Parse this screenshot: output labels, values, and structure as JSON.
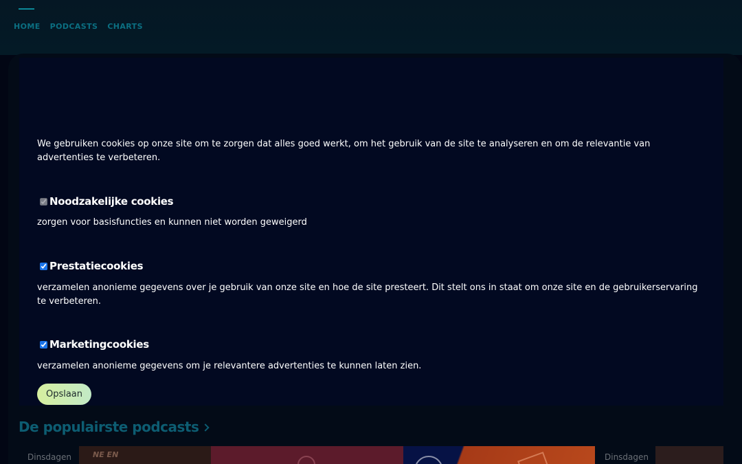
{
  "nav": {
    "items": [
      {
        "label": "HOME"
      },
      {
        "label": "PODCASTS"
      },
      {
        "label": "CHARTS"
      }
    ]
  },
  "cookie_modal": {
    "intro": "We gebruiken cookies op onze site om te zorgen dat alles goed werkt, om het gebruik van de site te analyseren en om de relevantie van advertenties te verbeteren.",
    "categories": [
      {
        "title": "Noodzakelijke cookies",
        "description": "zorgen voor basisfuncties en kunnen niet worden geweigerd",
        "checked": true,
        "disabled": true
      },
      {
        "title": "Prestatiecookies",
        "description": "verzamelen anonieme gegevens over je gebruik van onze site en hoe de site presteert. Dit stelt ons in staat om onze site en de gebruikerservaring te verbeteren.",
        "checked": true,
        "disabled": false
      },
      {
        "title": "Marketingcookies",
        "description": "verzamelen anonieme gegevens om je relevantere advertenties te kunnen laten zien.",
        "checked": true,
        "disabled": false
      }
    ],
    "save_label": "Opslaan"
  },
  "background": {
    "section_title": "De populairste podcasts",
    "tiles": [
      {
        "label": "Dinsdagen",
        "thumb_text": "NE EN"
      },
      {
        "label": "Dinsdagen"
      }
    ]
  },
  "colors": {
    "accent": "#0b6f82",
    "modal_bg": "#020921",
    "button_gradient_start": "#d6ef9f",
    "button_gradient_end": "#c2e9c6"
  }
}
